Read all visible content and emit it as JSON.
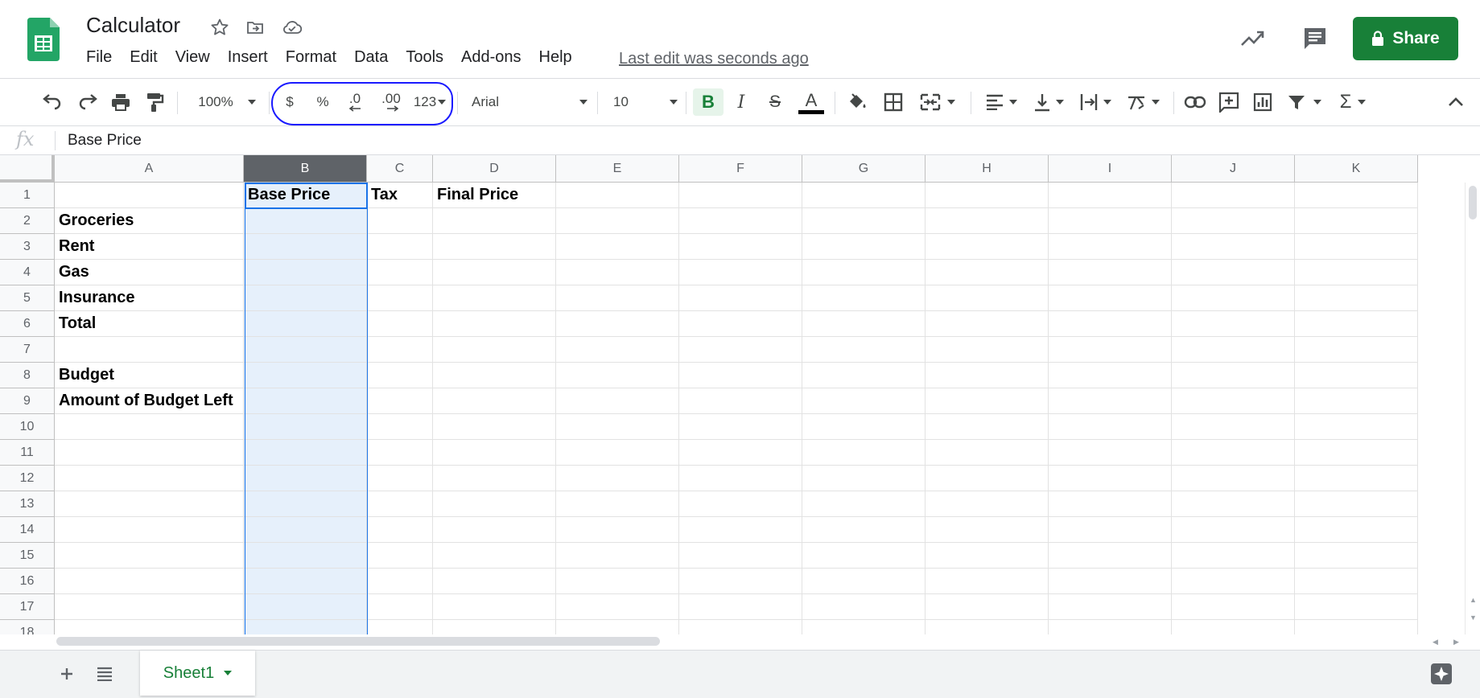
{
  "app": {
    "title": "Calculator",
    "last_edit": "Last edit was seconds ago",
    "share_label": "Share",
    "brand_color": "#188038"
  },
  "menu": [
    "File",
    "Edit",
    "View",
    "Insert",
    "Format",
    "Data",
    "Tools",
    "Add-ons",
    "Help"
  ],
  "toolbar": {
    "zoom": "100%",
    "currency": "$",
    "percent": "%",
    "decrease_decimal": ".0",
    "increase_decimal": ".00",
    "more_formats": "123",
    "font": "Arial",
    "font_size": "10",
    "bold": "B",
    "italic": "I",
    "strikethrough": "S",
    "text_color": "A",
    "annotation_color": "#1a1aff"
  },
  "formula_bar": {
    "fx_label": "fx",
    "value": "Base Price"
  },
  "columns": [
    "A",
    "B",
    "C",
    "D",
    "E",
    "F",
    "G",
    "H",
    "I",
    "J",
    "K"
  ],
  "rows": [
    "1",
    "2",
    "3",
    "4",
    "5",
    "6",
    "7",
    "8",
    "9",
    "10",
    "11",
    "12",
    "13",
    "14",
    "15",
    "16",
    "17",
    "18"
  ],
  "cells": {
    "B1": "Base Price",
    "C1": "Tax",
    "D1": "Final Price",
    "A2": "Groceries",
    "A3": "Rent",
    "A4": "Gas",
    "A5": "Insurance",
    "A6": "Total",
    "A8": "Budget",
    "A9": "Amount of Budget Left"
  },
  "selection": {
    "column": "B",
    "active_cell": "B1",
    "selection_color": "#e6f0fb",
    "accent": "#1a73e8"
  },
  "sheets": [
    {
      "name": "Sheet1",
      "active": true
    }
  ]
}
